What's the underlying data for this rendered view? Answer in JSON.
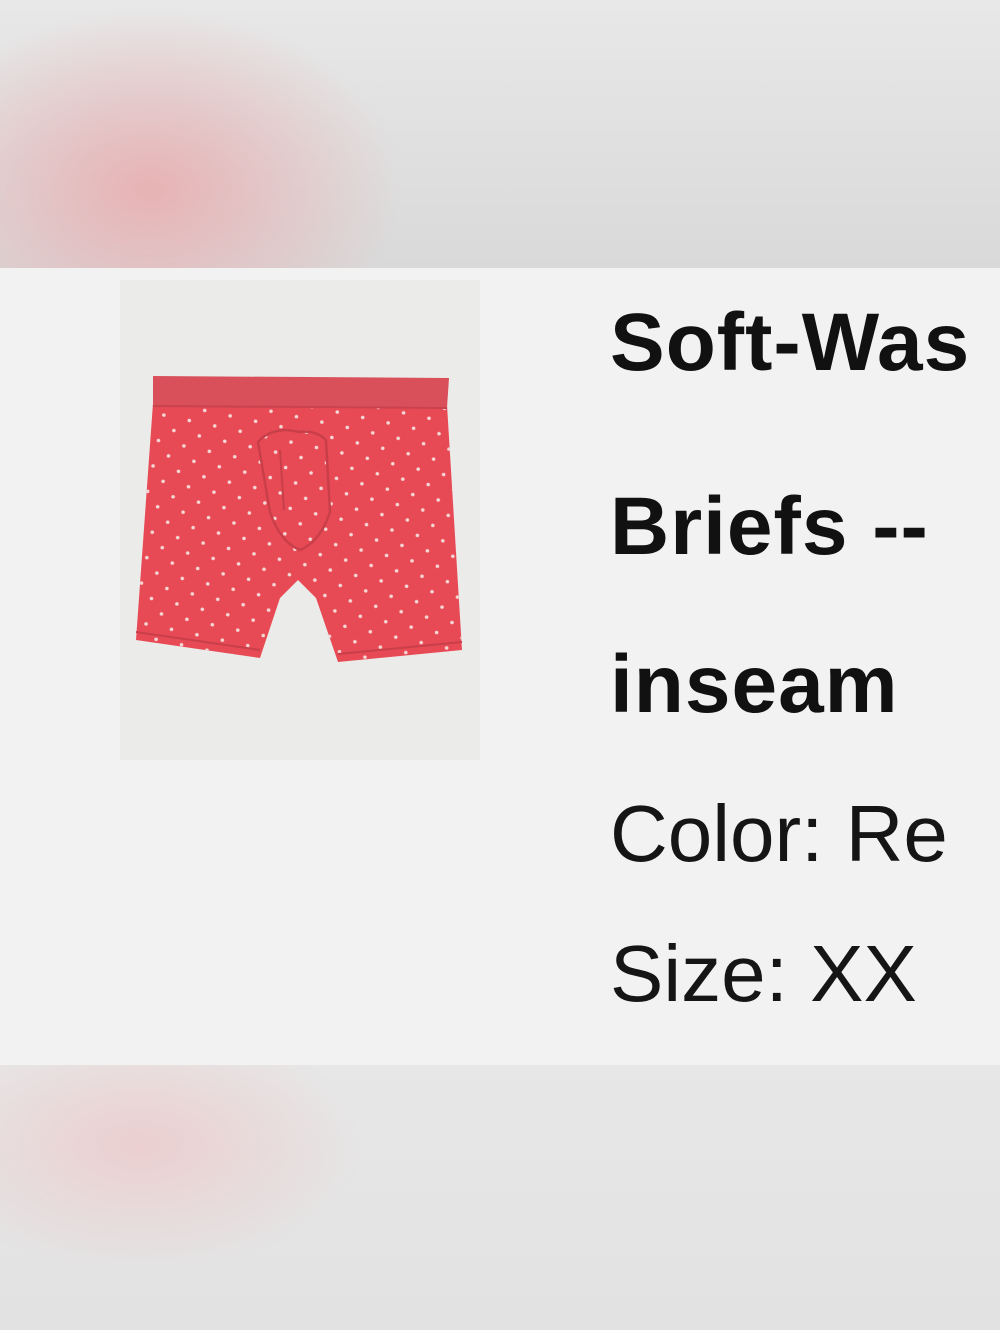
{
  "product": {
    "image_alt": "red boxer briefs with white dots",
    "title_lines": [
      "Soft-Was",
      "Briefs --",
      "inseam"
    ],
    "color_line": "Color: Re",
    "size_line": "Size: XX"
  },
  "colors": {
    "fabric": "#e84a55",
    "waistband": "#d9505a",
    "dot": "#f4d8d6"
  }
}
